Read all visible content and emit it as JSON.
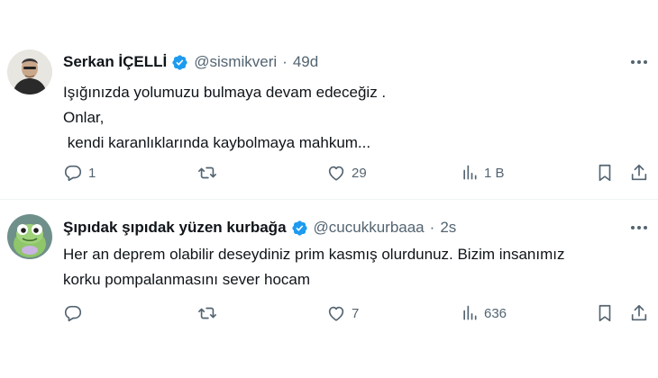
{
  "colors": {
    "text": "#0f1419",
    "secondary": "#536471",
    "verified": "#1d9bf0",
    "background": "#ffffff"
  },
  "tweets": [
    {
      "display_name": "Serkan İÇELLİ",
      "handle": "@sismikveri",
      "separator": "·",
      "time": "49d",
      "verified_icon": "verified-badge-icon",
      "lines": [
        "Işığınızda yolumuzu bulmaya devam edeceğiz .",
        "Onlar,",
        " kendi karanlıklarında kaybolmaya mahkum..."
      ],
      "reply_count": "1",
      "retweet_count": "",
      "like_count": "29",
      "view_count": "1 B"
    },
    {
      "display_name": "Şıpıdak şıpıdak yüzen kurbağa",
      "handle": "@cucukkurbaaa",
      "separator": "·",
      "time": "2s",
      "verified_icon": "verified-badge-icon",
      "lines": [
        "Her an deprem olabilir deseydiniz prim kasmış olurdunuz. Bizim insanımız",
        "korku pompalanmasını sever hocam"
      ],
      "reply_count": "",
      "retweet_count": "",
      "like_count": "7",
      "view_count": "636"
    }
  ]
}
